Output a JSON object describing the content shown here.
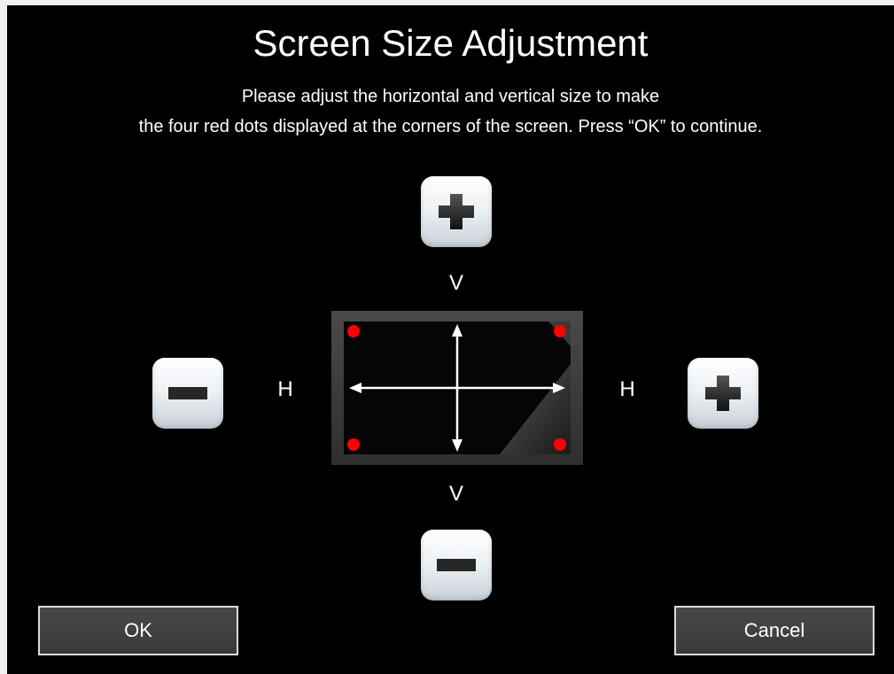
{
  "dialog": {
    "title": "Screen Size Adjustment",
    "instruction_line1": "Please adjust the horizontal and vertical size to make",
    "instruction_line2": "the four red dots displayed at the corners of the screen. Press “OK” to continue."
  },
  "controls": {
    "vertical_label": "V",
    "horizontal_label": "H",
    "v_plus_icon": "plus-icon",
    "v_minus_icon": "minus-icon",
    "h_plus_icon": "plus-icon",
    "h_minus_icon": "minus-icon"
  },
  "preview": {
    "corner_dot_color": "#ff0000",
    "arrow_color": "#ffffff"
  },
  "footer": {
    "ok_label": "OK",
    "cancel_label": "Cancel"
  },
  "colors": {
    "background": "#000000",
    "button_face": "#eef2f5",
    "glyph": "#2a2a2a"
  }
}
